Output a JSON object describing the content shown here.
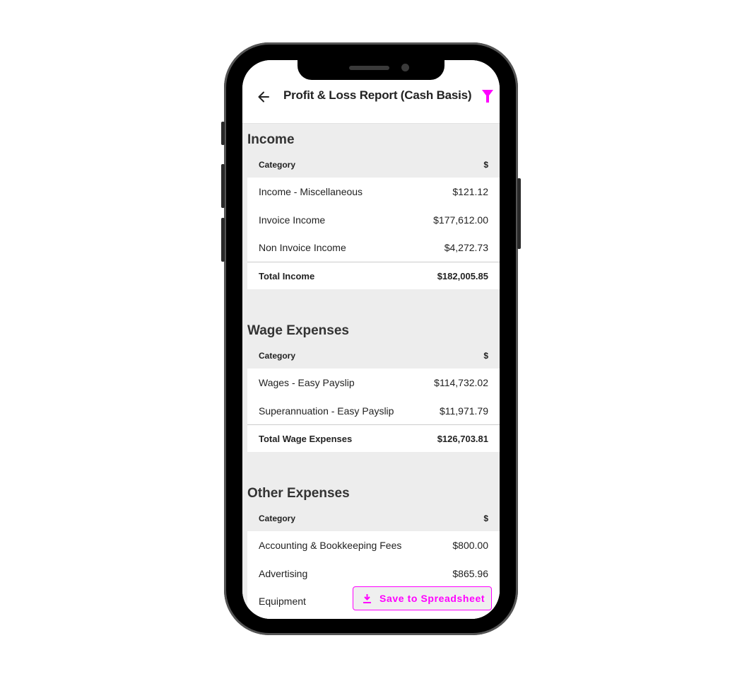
{
  "header": {
    "title": "Profit & Loss Report (Cash Basis)",
    "back_icon": "arrow-left-icon",
    "filter_icon": "filter-icon"
  },
  "colors": {
    "accent": "#ff00ff",
    "background": "#ededed",
    "card": "#ffffff",
    "text": "#222222"
  },
  "sections": [
    {
      "title": "Income",
      "col_category": "Category",
      "col_amount": "$",
      "rows": [
        {
          "category": "Income - Miscellaneous",
          "amount": "$121.12"
        },
        {
          "category": "Invoice Income",
          "amount": "$177,612.00"
        },
        {
          "category": "Non Invoice Income",
          "amount": "$4,272.73"
        }
      ],
      "total": {
        "label": "Total Income",
        "amount": "$182,005.85"
      }
    },
    {
      "title": "Wage Expenses",
      "col_category": "Category",
      "col_amount": "$",
      "rows": [
        {
          "category": "Wages - Easy Payslip",
          "amount": "$114,732.02"
        },
        {
          "category": "Superannuation - Easy Payslip",
          "amount": "$11,971.79"
        }
      ],
      "total": {
        "label": "Total Wage Expenses",
        "amount": "$126,703.81"
      }
    },
    {
      "title": "Other Expenses",
      "col_category": "Category",
      "col_amount": "$",
      "rows": [
        {
          "category": "Accounting & Bookkeeping Fees",
          "amount": "$800.00"
        },
        {
          "category": "Advertising",
          "amount": "$865.96"
        },
        {
          "category": "Equipment",
          "amount": ""
        }
      ]
    }
  ],
  "save_button": {
    "label": "Save to Spreadsheet",
    "icon": "download-icon"
  }
}
